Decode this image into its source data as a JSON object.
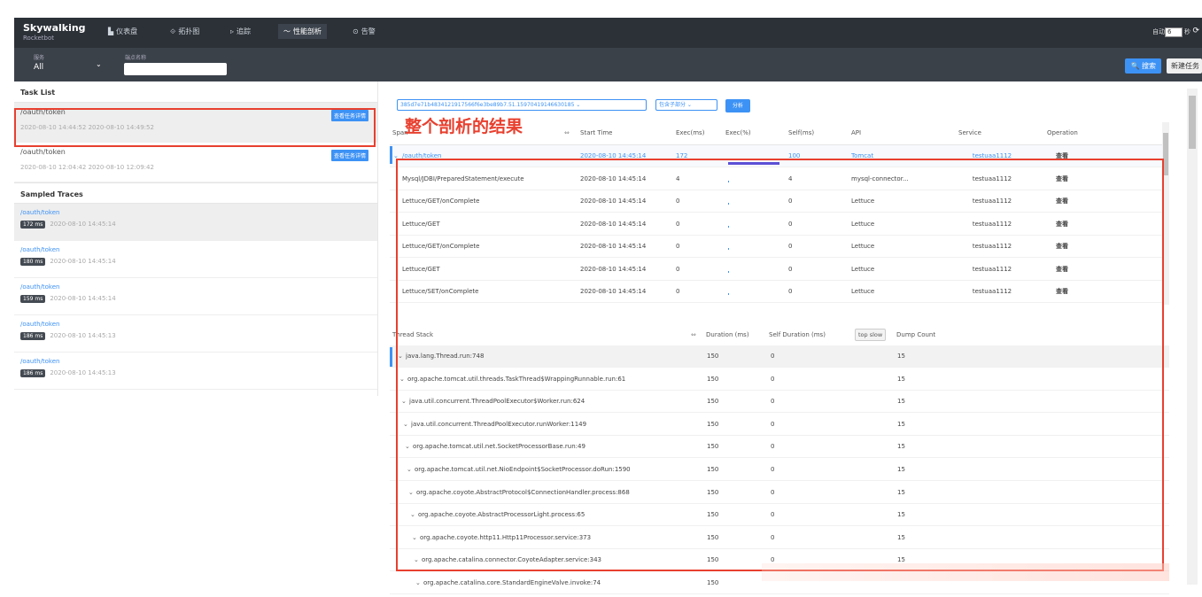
{
  "header": {
    "logo_title": "Skywalking",
    "logo_sub": "Rocketbot",
    "nav": [
      {
        "icon": "▙",
        "label": "仪表盘"
      },
      {
        "icon": "⟐",
        "label": "拓扑图"
      },
      {
        "icon": "▹",
        "label": "追踪"
      },
      {
        "icon": "〜",
        "label": "性能剖析"
      },
      {
        "icon": "⊙",
        "label": "告警"
      }
    ],
    "auto_label": "自动",
    "auto_value": "6",
    "secs_label": "秒",
    "refresh_icon": "⟳"
  },
  "subbar": {
    "service_label": "服务",
    "service_value": "All",
    "endpoint_label": "端点名称",
    "search_label": "🔍 搜索",
    "new_task_label": "新建任务"
  },
  "tasks": {
    "title": "Task List",
    "btn": "查看任务详情",
    "items": [
      {
        "name": "/oauth/token",
        "time": "2020-08-10 14:44:52   2020-08-10 14:49:52"
      },
      {
        "name": "/oauth/token",
        "time": "2020-08-10 12:04:42   2020-08-10 12:09:42"
      }
    ]
  },
  "traces": {
    "title": "Sampled Traces",
    "items": [
      {
        "name": "/oauth/token",
        "ms": "172 ms",
        "time": "2020-08-10 14:45:14"
      },
      {
        "name": "/oauth/token",
        "ms": "180 ms",
        "time": "2020-08-10 14:45:14"
      },
      {
        "name": "/oauth/token",
        "ms": "159 ms",
        "time": "2020-08-10 14:45:14"
      },
      {
        "name": "/oauth/token",
        "ms": "186 ms",
        "time": "2020-08-10 14:45:13"
      },
      {
        "name": "/oauth/token",
        "ms": "186 ms",
        "time": "2020-08-10 14:45:13"
      }
    ]
  },
  "controls": {
    "trace_id": "385d7e71b4834121917566f6e3be89b7.51.15970419146630185",
    "mode": "包含子部分",
    "analyze": "分析"
  },
  "annotation": "整个剖析的结果",
  "spans": {
    "headers": [
      "Span",
      "Start Time",
      "Exec(ms)",
      "Exec(%)",
      "Self(ms)",
      "API",
      "Service",
      "Operation"
    ],
    "rows": [
      {
        "span": "/oauth/token",
        "start": "2020-08-10 14:45:14",
        "exec": "172",
        "self": "100",
        "api": "Tomcat",
        "service": "testuaa1112",
        "op": "查看",
        "pct": 1.0,
        "link": true
      },
      {
        "span": "Mysql/JDBI/PreparedStatement/execute",
        "start": "2020-08-10 14:45:14",
        "exec": "4",
        "self": "4",
        "api": "mysql-connector...",
        "service": "testuaa1112",
        "op": "查看",
        "pct": 0.02
      },
      {
        "span": "Lettuce/GET/onComplete",
        "start": "2020-08-10 14:45:14",
        "exec": "0",
        "self": "0",
        "api": "Lettuce",
        "service": "testuaa1112",
        "op": "查看",
        "pct": 0.0
      },
      {
        "span": "Lettuce/GET",
        "start": "2020-08-10 14:45:14",
        "exec": "0",
        "self": "0",
        "api": "Lettuce",
        "service": "testuaa1112",
        "op": "查看",
        "pct": 0.0
      },
      {
        "span": "Lettuce/GET/onComplete",
        "start": "2020-08-10 14:45:14",
        "exec": "0",
        "self": "0",
        "api": "Lettuce",
        "service": "testuaa1112",
        "op": "查看",
        "pct": 0.0
      },
      {
        "span": "Lettuce/GET",
        "start": "2020-08-10 14:45:14",
        "exec": "0",
        "self": "0",
        "api": "Lettuce",
        "service": "testuaa1112",
        "op": "查看",
        "pct": 0.0
      },
      {
        "span": "Lettuce/SET/onComplete",
        "start": "2020-08-10 14:45:14",
        "exec": "0",
        "self": "0",
        "api": "Lettuce",
        "service": "testuaa1112",
        "op": "查看",
        "pct": 0.0
      }
    ]
  },
  "stack": {
    "headers": [
      "Thread Stack",
      "Duration (ms)",
      "Self Duration (ms)",
      "top slow",
      "Dump Count"
    ],
    "rows": [
      {
        "frame": "java.lang.Thread.run:748",
        "dur": "150",
        "self": "0",
        "count": "15"
      },
      {
        "frame": "org.apache.tomcat.util.threads.TaskThread$WrappingRunnable.run:61",
        "dur": "150",
        "self": "0",
        "count": "15"
      },
      {
        "frame": "java.util.concurrent.ThreadPoolExecutor$Worker.run:624",
        "dur": "150",
        "self": "0",
        "count": "15"
      },
      {
        "frame": "java.util.concurrent.ThreadPoolExecutor.runWorker:1149",
        "dur": "150",
        "self": "0",
        "count": "15"
      },
      {
        "frame": "org.apache.tomcat.util.net.SocketProcessorBase.run:49",
        "dur": "150",
        "self": "0",
        "count": "15"
      },
      {
        "frame": "org.apache.tomcat.util.net.NioEndpoint$SocketProcessor.doRun:1590",
        "dur": "150",
        "self": "0",
        "count": "15"
      },
      {
        "frame": "org.apache.coyote.AbstractProtocol$ConnectionHandler.process:868",
        "dur": "150",
        "self": "0",
        "count": "15"
      },
      {
        "frame": "org.apache.coyote.AbstractProcessorLight.process:65",
        "dur": "150",
        "self": "0",
        "count": "15"
      },
      {
        "frame": "org.apache.coyote.http11.Http11Processor.service:373",
        "dur": "150",
        "self": "0",
        "count": "15"
      },
      {
        "frame": "org.apache.catalina.connector.CoyoteAdapter.service:343",
        "dur": "150",
        "self": "0",
        "count": "15"
      },
      {
        "frame": "org.apache.catalina.core.StandardEngineValve.invoke:74",
        "dur": "150",
        "self": "",
        "count": ""
      }
    ]
  }
}
